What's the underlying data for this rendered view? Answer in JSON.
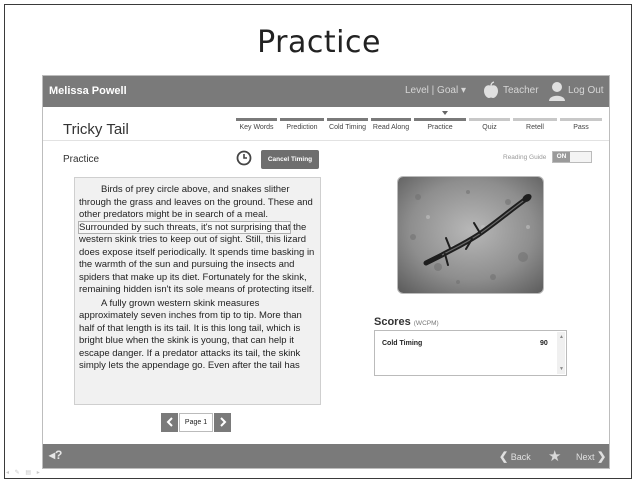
{
  "slide": {
    "title": "Practice"
  },
  "header": {
    "user_name": "Melissa Powell",
    "level_goal": "Level | Goal ▾",
    "teacher": "Teacher",
    "logout": "Log Out"
  },
  "lesson": {
    "title": "Tricky Tail"
  },
  "steps": [
    {
      "label": "Key Words"
    },
    {
      "label": "Prediction"
    },
    {
      "label": "Cold Timing"
    },
    {
      "label": "Read Along"
    },
    {
      "label": "Practice"
    },
    {
      "label": "Quiz"
    },
    {
      "label": "Retell"
    },
    {
      "label": "Pass"
    }
  ],
  "practice": {
    "label": "Practice",
    "cancel_label": "Cancel Timing",
    "reading_guide_label": "Reading Guide",
    "reading_guide_state": "ON",
    "paragraph1_pre": "Birds of prey circle above, and snakes slither through the grass and leaves on the ground. These and other predators might be in search of a meal. ",
    "paragraph1_highlight": "Surrounded by such threats, it's not surprising that",
    "paragraph1_post": " the western skink tries to keep out of sight. Still, this lizard does expose itself periodically. It spends time basking in the warmth of the sun and pursuing the insects and spiders that make up its diet. Fortunately for the skink, remaining hidden isn't its sole means of protecting itself.",
    "paragraph2": "A fully grown western skink measures approximately seven inches from tip to tip. More than half of that length is its tail. It is this long tail, which is bright blue when the skink is young, that can help it escape danger. If a predator attacks its tail, the skink simply lets the appendage go. Even after the tail has",
    "page_label": "Page 1",
    "prev_icon": "chevron-left",
    "next_icon": "chevron-right"
  },
  "scores": {
    "title": "Scores",
    "unit": "(WCPM)",
    "rows": [
      {
        "name": "Cold Timing",
        "value": "90"
      }
    ]
  },
  "footer": {
    "help": "?",
    "back": "Back",
    "next": "Next"
  },
  "colors": {
    "bar": "#7a7a7a",
    "accent_inactive": "#c8c8c8"
  }
}
